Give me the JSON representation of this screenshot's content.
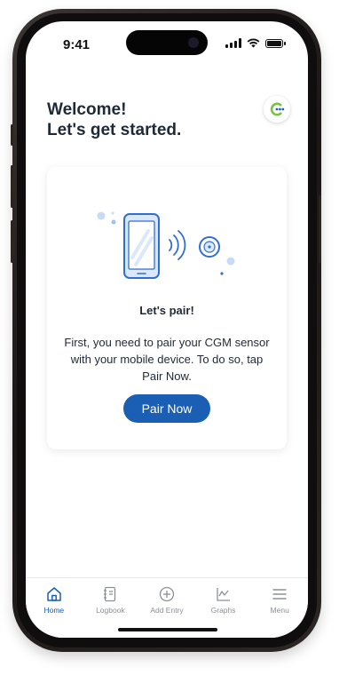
{
  "status_bar": {
    "time": "9:41"
  },
  "header": {
    "welcome_line1": "Welcome!",
    "welcome_line2": "Let's get started."
  },
  "pair_card": {
    "title": "Let's pair!",
    "body": "First, you need to pair your CGM sensor with your mobile device. To do so, tap Pair Now.",
    "button_label": "Pair Now"
  },
  "nav": {
    "items": [
      {
        "label": "Home",
        "icon": "home-icon",
        "active": true
      },
      {
        "label": "Logbook",
        "icon": "logbook-icon",
        "active": false
      },
      {
        "label": "Add Entry",
        "icon": "add-entry-icon",
        "active": false
      },
      {
        "label": "Graphs",
        "icon": "graphs-icon",
        "active": false
      },
      {
        "label": "Menu",
        "icon": "menu-icon",
        "active": false
      }
    ]
  },
  "colors": {
    "primary": "#1a5fb4",
    "text": "#1f2937",
    "nav_inactive": "#8a8f98",
    "illustration_blue": "#2f6fd0",
    "illustration_light": "#dbe8fb",
    "logo_green": "#7ac142"
  }
}
